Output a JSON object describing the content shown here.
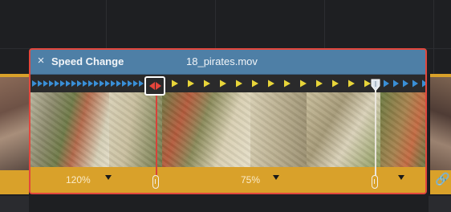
{
  "clip": {
    "close_icon": "×",
    "title": "Speed Change",
    "filename": "18_pirates.mov"
  },
  "speed_segments": [
    {
      "label": "120%"
    },
    {
      "label": "75%"
    }
  ],
  "icons": {
    "close": "close-icon",
    "link": "link-icon",
    "dropdown": "chevron-down-icon"
  },
  "colors": {
    "clip_header": "#4e7fa6",
    "clip_border": "#e2473d",
    "speed_strip": "#d9a12a",
    "fast_arrows": "#3a8fd6",
    "normal_arrows": "#e8d53a",
    "speed_point": "#e5453b"
  }
}
